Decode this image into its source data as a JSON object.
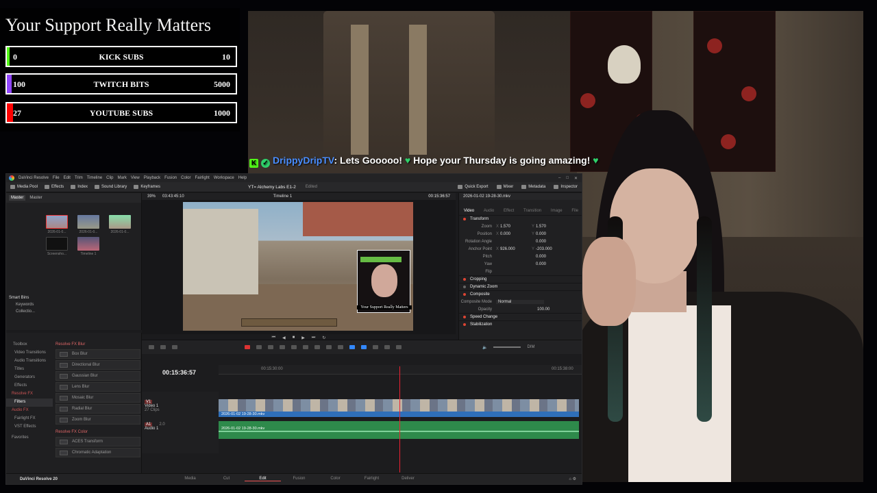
{
  "goals": {
    "title": "Your Support Really Matters",
    "bars": [
      {
        "name": "KICK SUBS",
        "current": "0",
        "goal": "10",
        "fill_fraction": 0.0,
        "color": "#53fc18"
      },
      {
        "name": "TWITCH BITS",
        "current": "100",
        "goal": "5000",
        "fill_fraction": 0.02,
        "color": "#9146ff"
      },
      {
        "name": "YOUTUBE SUBS",
        "current": "27",
        "goal": "1000",
        "fill_fraction": 0.027,
        "color": "#ff0000"
      }
    ]
  },
  "chat": {
    "username": "DrippyDripTV",
    "message": ": Lets Gooooo! ",
    "message2": " Hope your Thursday is going amazing! ",
    "heart": "♥",
    "badges": [
      "kick-icon",
      "verified-icon"
    ]
  },
  "resolve": {
    "menu": [
      "DaVinci Resolve",
      "File",
      "Edit",
      "Trim",
      "Timeline",
      "Clip",
      "Mark",
      "View",
      "Playback",
      "Fusion",
      "Color",
      "Fairlight",
      "Workspace",
      "Help"
    ],
    "toolbar_left": [
      "Media Pool",
      "Effects",
      "Index",
      "Sound Library",
      "Keyframes"
    ],
    "project_title": "YT= Alchemy Labs E1-2",
    "edited": "Edited",
    "toolbar_right": [
      "Quick Export",
      "Mixer",
      "Metadata",
      "Inspector"
    ],
    "pool_tabs": [
      "Master",
      "Master"
    ],
    "pool_clips": [
      "2026-01-0...",
      "2026-01-0...",
      "2026-01-0...",
      "Screensho...",
      "Timeline 1"
    ],
    "smart_bins": [
      "Smart Bins",
      "Keywords",
      "Collectio..."
    ],
    "viewer": {
      "zoom": "39%",
      "duration": "03:43:45:10",
      "timeline_name": "Timeline 1",
      "timecode": "00:15:36:57",
      "pip_caption": "Your Support Really Matters"
    },
    "inspector": {
      "clip": "2026-01-02 19-28-30.mkv",
      "tabs": [
        "Video",
        "Audio",
        "Effect",
        "Transition",
        "Image",
        "File"
      ],
      "sections": [
        "Transform",
        "Cropping",
        "Dynamic Zoom",
        "Composite",
        "Speed Change",
        "Stabilization"
      ],
      "rows": [
        {
          "label": "Zoom",
          "x": "1.570",
          "y": "1.570"
        },
        {
          "label": "Position",
          "x": "0.000",
          "y": "0.000"
        },
        {
          "label": "Rotation Angle",
          "x": "",
          "y": "0.000"
        },
        {
          "label": "Anchor Point",
          "x": "926.000",
          "y": "-203.000"
        },
        {
          "label": "Pitch",
          "x": "",
          "y": "0.000"
        },
        {
          "label": "Yaw",
          "x": "",
          "y": "0.000"
        },
        {
          "label": "Flip",
          "x": "",
          "y": ""
        }
      ],
      "composite_mode_label": "Composite Mode",
      "composite_mode": "Normal",
      "opacity_label": "Opacity",
      "opacity": "100.00"
    },
    "fx_tree": [
      "Toolbox",
      "Video Transitions",
      "Audio Transitions",
      "Titles",
      "Generators",
      "Effects",
      "Resolve FX",
      "Filters",
      "Audio FX",
      "Fairlight FX",
      "VST Effects",
      "Favorites"
    ],
    "fx_list_cat": "Resolve FX Blur",
    "fx_list": [
      "Box Blur",
      "Directional Blur",
      "Gaussian Blur",
      "Lens Blur",
      "Mosaic Blur",
      "Radial Blur",
      "Zoom Blur"
    ],
    "fx_list_cat2": "Resolve FX Color",
    "fx_list2": [
      "ACES Transform",
      "Chromatic Adaptation"
    ],
    "timeline": {
      "timecode": "00:15:36:57",
      "ruler": [
        "00:15:30:00",
        "00:15:38:00"
      ],
      "video_track": {
        "badge": "V1",
        "name": "Video 1",
        "clips": "27 Clips",
        "clip_name": "2026-01-02 19-28-30.mkv"
      },
      "audio_track": {
        "badge": "A1",
        "name": "Audio 1",
        "level": "2.0",
        "clip_name": "2026-01-02 19-28-30.mkv"
      },
      "volume": "DIM"
    },
    "brand": "DaVinci Resolve 20",
    "pages": [
      "Media",
      "Cut",
      "Edit",
      "Fusion",
      "Color",
      "Fairlight",
      "Deliver"
    ],
    "active_page": "Edit"
  }
}
